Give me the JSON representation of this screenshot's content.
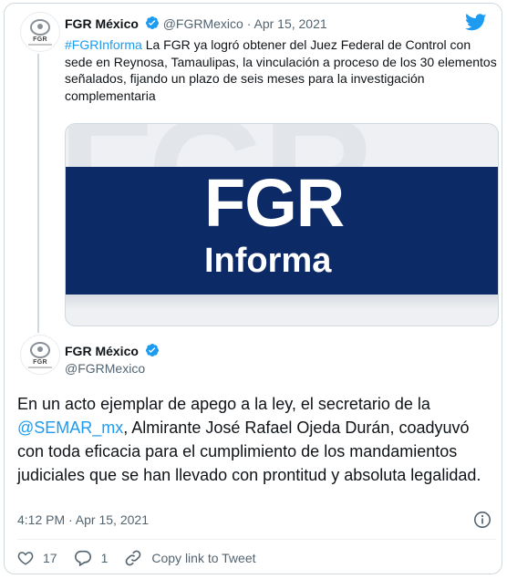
{
  "quoted_tweet": {
    "author_name": "FGR México",
    "handle": "@FGRMexico",
    "separator": "·",
    "date": "Apr 15, 2021",
    "hashtag": "#FGRInforma",
    "text": " La FGR ya logró obtener del Juez Federal de Control con sede en Reynosa, Tamaulipas, la vinculación a proceso de los 30 elementos señalados, fijando un plazo de seis meses para la investigación complementaria",
    "media": {
      "background_letters": "FGR",
      "title": "FGR",
      "subtitle": "Informa"
    },
    "avatar_abbr": "FGR"
  },
  "main_tweet": {
    "author_name": "FGR México",
    "handle": "@FGRMexico",
    "avatar_abbr": "FGR",
    "text_before": "En un acto ejemplar de apego a la ley, el secretario de la ",
    "mention": "@SEMAR_mx",
    "text_after": ", Almirante José Rafael Ojeda Durán, coadyuvó con toda eficacia para el cumplimiento de los mandamientos judiciales que se han llevado con prontitud y absoluta legalidad.",
    "timestamp": "4:12 PM · Apr 15, 2021"
  },
  "actions": {
    "likes": "17",
    "replies": "1",
    "copy_link": "Copy link to Tweet"
  },
  "colors": {
    "link_blue": "#1d9bf0",
    "band_navy": "#0c2a66",
    "muted_text": "#536471"
  },
  "icons": [
    "twitter-bird-icon",
    "verified-badge-icon",
    "info-icon",
    "heart-icon",
    "reply-icon",
    "link-icon"
  ]
}
